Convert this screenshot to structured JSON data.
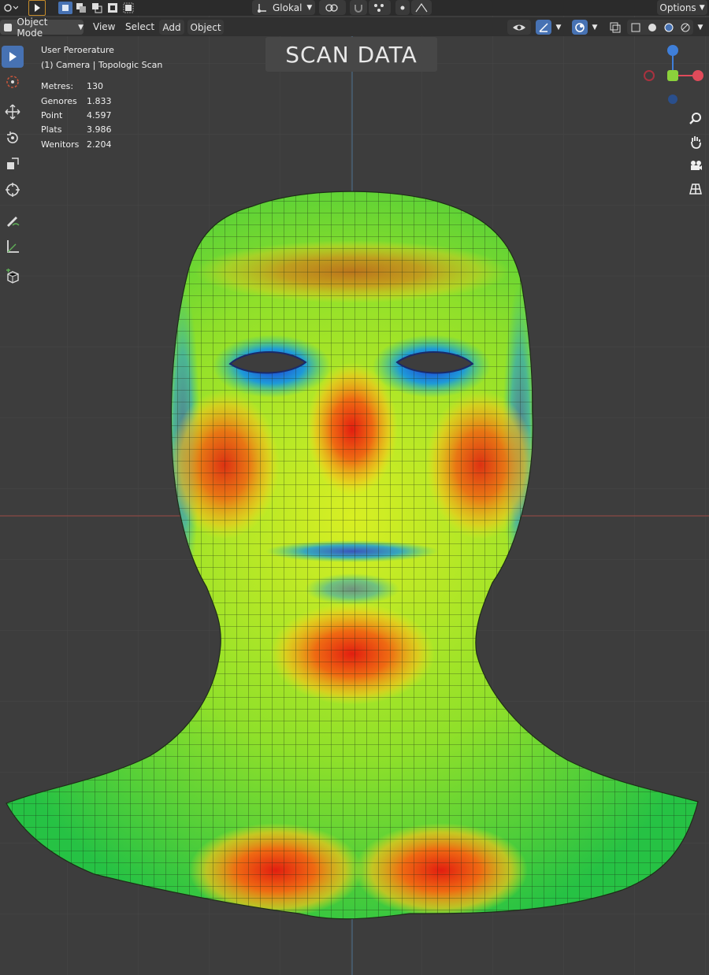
{
  "header": {
    "transform_orientation": "Glokal",
    "options_label": "Options",
    "mode_label": "Object Mode",
    "menu": [
      "View",
      "Select",
      "Add",
      "Object"
    ]
  },
  "overlay": {
    "view_name": "User Peroerature",
    "object_name": "(1) Camera | Topologic Scan",
    "stats": [
      {
        "label": "Metres:",
        "value": "130"
      },
      {
        "label": "Genores",
        "value": "1.833"
      },
      {
        "label": "Point",
        "value": "4.597"
      },
      {
        "label": "Plats",
        "value": "3.986"
      },
      {
        "label": "Wenitors",
        "value": "2.204"
      }
    ]
  },
  "viewport_label": "SCAN DATA",
  "colors": {
    "viewport_bg": "#3d3d3d",
    "accent": "#4772b3",
    "axis_x": "#e04b5a",
    "axis_y": "#8bd13b",
    "axis_z": "#3f7fd9",
    "heat_high": "#e21e10",
    "heat_mid": "#f3e21c",
    "heat_low": "#24c63c",
    "heat_min": "#1f3ad6"
  },
  "tools": [
    "select-box-icon",
    "cursor-icon",
    "move-icon",
    "rotate-icon",
    "scale-icon",
    "transform-icon",
    "annotate-icon",
    "measure-icon",
    "add-cube-icon"
  ]
}
